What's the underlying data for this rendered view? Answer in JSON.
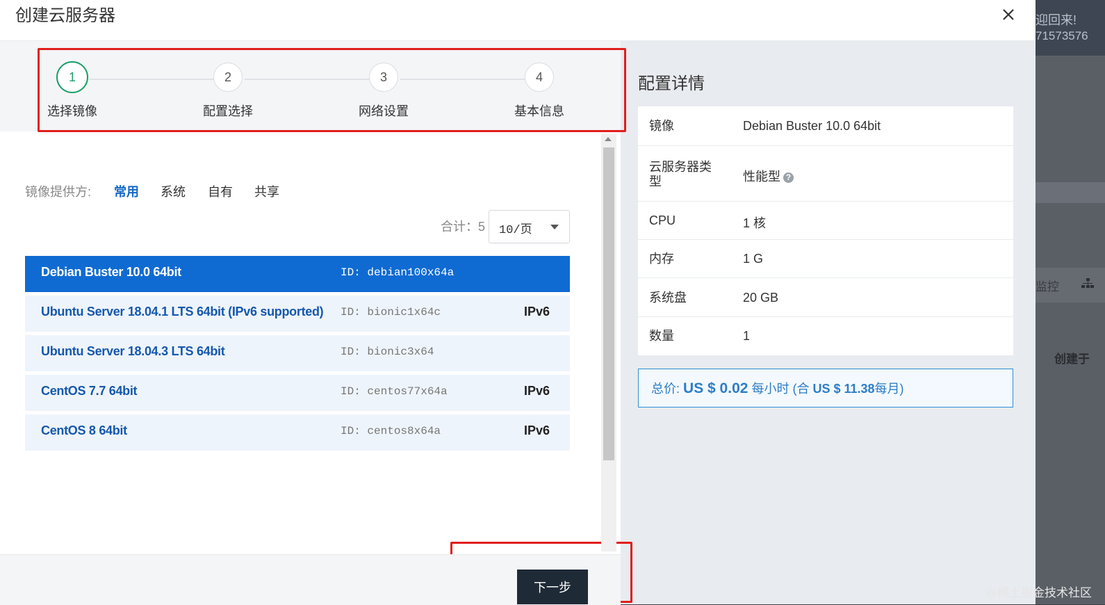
{
  "background": {
    "welcome": "迎回来!",
    "account_id": "71573576",
    "monitor": "监控",
    "created_at": "创建于"
  },
  "watermark": "@稀土掘金技术社区",
  "modal": {
    "title": "创建云服务器",
    "close_icon": "close-icon"
  },
  "steps": [
    {
      "number": "1",
      "label": "选择镜像",
      "active": true
    },
    {
      "number": "2",
      "label": "配置选择",
      "active": false
    },
    {
      "number": "3",
      "label": "网络设置",
      "active": false
    },
    {
      "number": "4",
      "label": "基本信息",
      "active": false
    }
  ],
  "image_provider": {
    "label": "镜像提供方:",
    "tabs": [
      "常用",
      "系统",
      "自有",
      "共享"
    ],
    "active_tab": "常用"
  },
  "pagination": {
    "total": "合计：5",
    "page_size": "10/页"
  },
  "images": [
    {
      "name": "Debian Buster 10.0 64bit",
      "id": "ID: debian100x64a",
      "tag": "",
      "selected": true
    },
    {
      "name": "Ubuntu Server 18.04.1 LTS 64bit (IPv6 supported)",
      "id": "ID: bionic1x64c",
      "tag": "IPv6",
      "selected": false
    },
    {
      "name": "Ubuntu Server 18.04.3 LTS 64bit",
      "id": "ID: bionic3x64",
      "tag": "",
      "selected": false
    },
    {
      "name": "CentOS 7.7 64bit",
      "id": "ID: centos77x64a",
      "tag": "IPv6",
      "selected": false
    },
    {
      "name": "CentOS 8 64bit",
      "id": "ID: centos8x64a",
      "tag": "IPv6",
      "selected": false
    }
  ],
  "footer": {
    "next_label": "下一步"
  },
  "details": {
    "title": "配置详情",
    "rows": [
      {
        "key": "镜像",
        "value": "Debian Buster 10.0 64bit"
      },
      {
        "key": "云服务器类型",
        "value": "性能型"
      },
      {
        "key": "CPU",
        "value": "1 核"
      },
      {
        "key": "内存",
        "value": "1 G"
      },
      {
        "key": "系统盘",
        "value": "20 GB"
      },
      {
        "key": "数量",
        "value": "1"
      }
    ]
  },
  "price": {
    "label": "总价:",
    "hourly": "US $ 0.02",
    "per_hour": "每小时 (合",
    "monthly": "US $ 11.38",
    "per_month": "每月)"
  },
  "colors": {
    "accent_blue": "#0f6bd2",
    "step_active": "#1aa068",
    "annotation_red": "#e21d1d",
    "button_dark": "#1e2a36"
  }
}
